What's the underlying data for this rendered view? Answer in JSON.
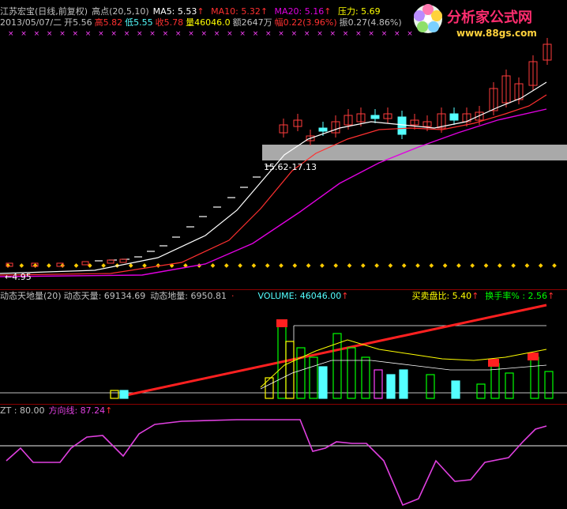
{
  "header": {
    "stock": "江苏宏宝(日线,前复权)",
    "high_label": "高点(20,5,10)",
    "ma5": "MA5: 5.53",
    "ma10": "MA10: 5.32",
    "ma20": "MA20: 5.16",
    "pressure": "压力: 5.69"
  },
  "quote": {
    "date": "2013/05/07/二",
    "open": "开5.56",
    "high": "高5.82",
    "low": "低5.55",
    "close": "收5.78",
    "volume": "量46046.0",
    "amount": "额2647万",
    "change": "幅0.22(3.96%)",
    "amplitude": "振0.27(4.86%)"
  },
  "logo": {
    "name": "分析家公式网",
    "url": "www.88gs.com"
  },
  "price_panel": {
    "range_label": "15.62-17.13",
    "low_label": "←4.95"
  },
  "volume_panel": {
    "title": "动态天地量(20)",
    "sky": "动态天量: 69134.69",
    "earth": "动态地量: 6950.81",
    "sep": "·",
    "volume": "VOLUME: 46046.00",
    "buy_sell": "买卖盘比: 5.40",
    "turnover": "换手率% : 2.56"
  },
  "zt_panel": {
    "name": "ZT : 80.00",
    "direction": "方向线: 87.24"
  },
  "colors": {
    "up": "#ff3c3c",
    "down": "#54ffff",
    "ma5": "#ffffff",
    "ma10": "#ff3030",
    "ma20": "#e000e0",
    "zt_line": "#e040e0",
    "yellow": "#ffff00"
  }
}
